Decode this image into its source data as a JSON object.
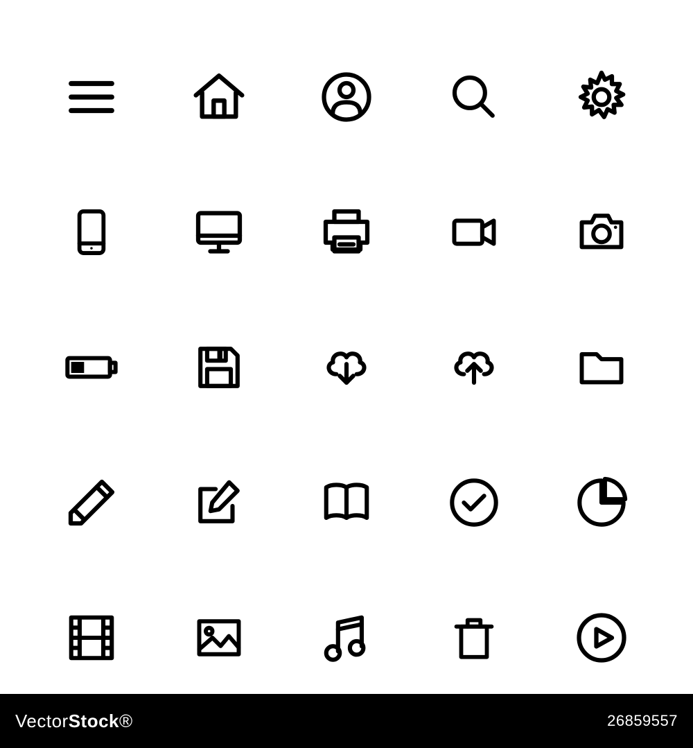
{
  "icons": [
    {
      "name": "menu-icon"
    },
    {
      "name": "home-icon"
    },
    {
      "name": "user-circle-icon"
    },
    {
      "name": "search-icon"
    },
    {
      "name": "gear-icon"
    },
    {
      "name": "smartphone-icon"
    },
    {
      "name": "monitor-icon"
    },
    {
      "name": "printer-icon"
    },
    {
      "name": "video-camera-icon"
    },
    {
      "name": "camera-icon"
    },
    {
      "name": "battery-icon"
    },
    {
      "name": "save-floppy-icon"
    },
    {
      "name": "cloud-download-icon"
    },
    {
      "name": "cloud-upload-icon"
    },
    {
      "name": "folder-icon"
    },
    {
      "name": "pencil-icon"
    },
    {
      "name": "edit-note-icon"
    },
    {
      "name": "book-icon"
    },
    {
      "name": "check-circle-icon"
    },
    {
      "name": "pie-chart-icon"
    },
    {
      "name": "film-icon"
    },
    {
      "name": "image-icon"
    },
    {
      "name": "music-note-icon"
    },
    {
      "name": "trash-icon"
    },
    {
      "name": "play-circle-icon"
    }
  ],
  "footer": {
    "brand_prefix": "Vector",
    "brand_suffix": "Stock",
    "image_id": "26859557"
  }
}
